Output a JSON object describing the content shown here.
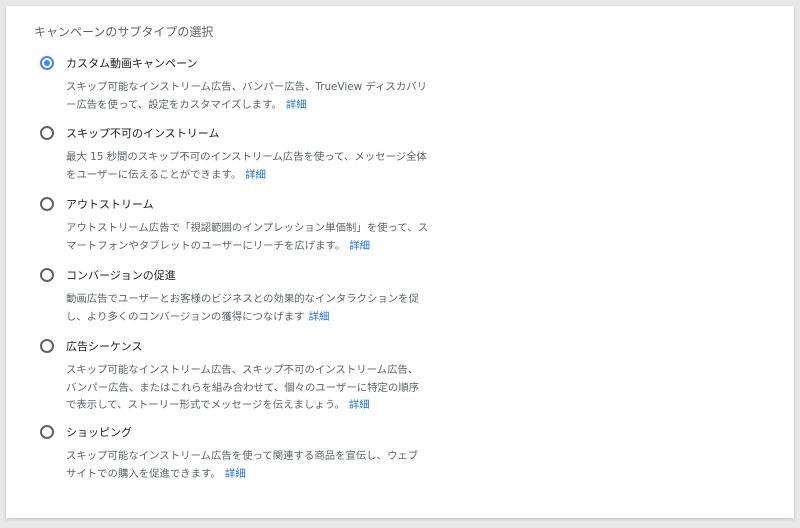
{
  "section": {
    "title": "キャンペーンのサブタイプの選択"
  },
  "more_link": "詳細",
  "colors": {
    "accent": "#4285f4",
    "link": "#1a73e8"
  },
  "options": [
    {
      "label": "カスタム動画キャンペーン",
      "description": "スキップ可能なインストリーム広告、バンパー広告、TrueView ディスカバリー広告を使って、設定をカスタマイズします。",
      "selected": true
    },
    {
      "label": "スキップ不可のインストリーム",
      "description": "最大 15 秒間のスキップ不可のインストリーム広告を使って、メッセージ全体をユーザーに伝えることができます。",
      "selected": false
    },
    {
      "label": "アウトストリーム",
      "description": "アウトストリーム広告で「視認範囲のインプレッション単価制」を使って、スマートフォンやタブレットのユーザーにリーチを広げます。",
      "selected": false
    },
    {
      "label": "コンバージョンの促進",
      "description": "動画広告でユーザーとお客様のビジネスとの効果的なインタラクションを促し、より多くのコンバージョンの獲得につなげます",
      "selected": false
    },
    {
      "label": "広告シーケンス",
      "description": "スキップ可能なインストリーム広告、スキップ不可のインストリーム広告、バンパー広告、またはこれらを組み合わせて、個々のユーザーに特定の順序で表示して、ストーリー形式でメッセージを伝えましょう。",
      "selected": false
    },
    {
      "label": "ショッピング",
      "description": "スキップ可能なインストリーム広告を使って関連する商品を宣伝し、ウェブサイトでの購入を促進できます。",
      "selected": false
    }
  ]
}
